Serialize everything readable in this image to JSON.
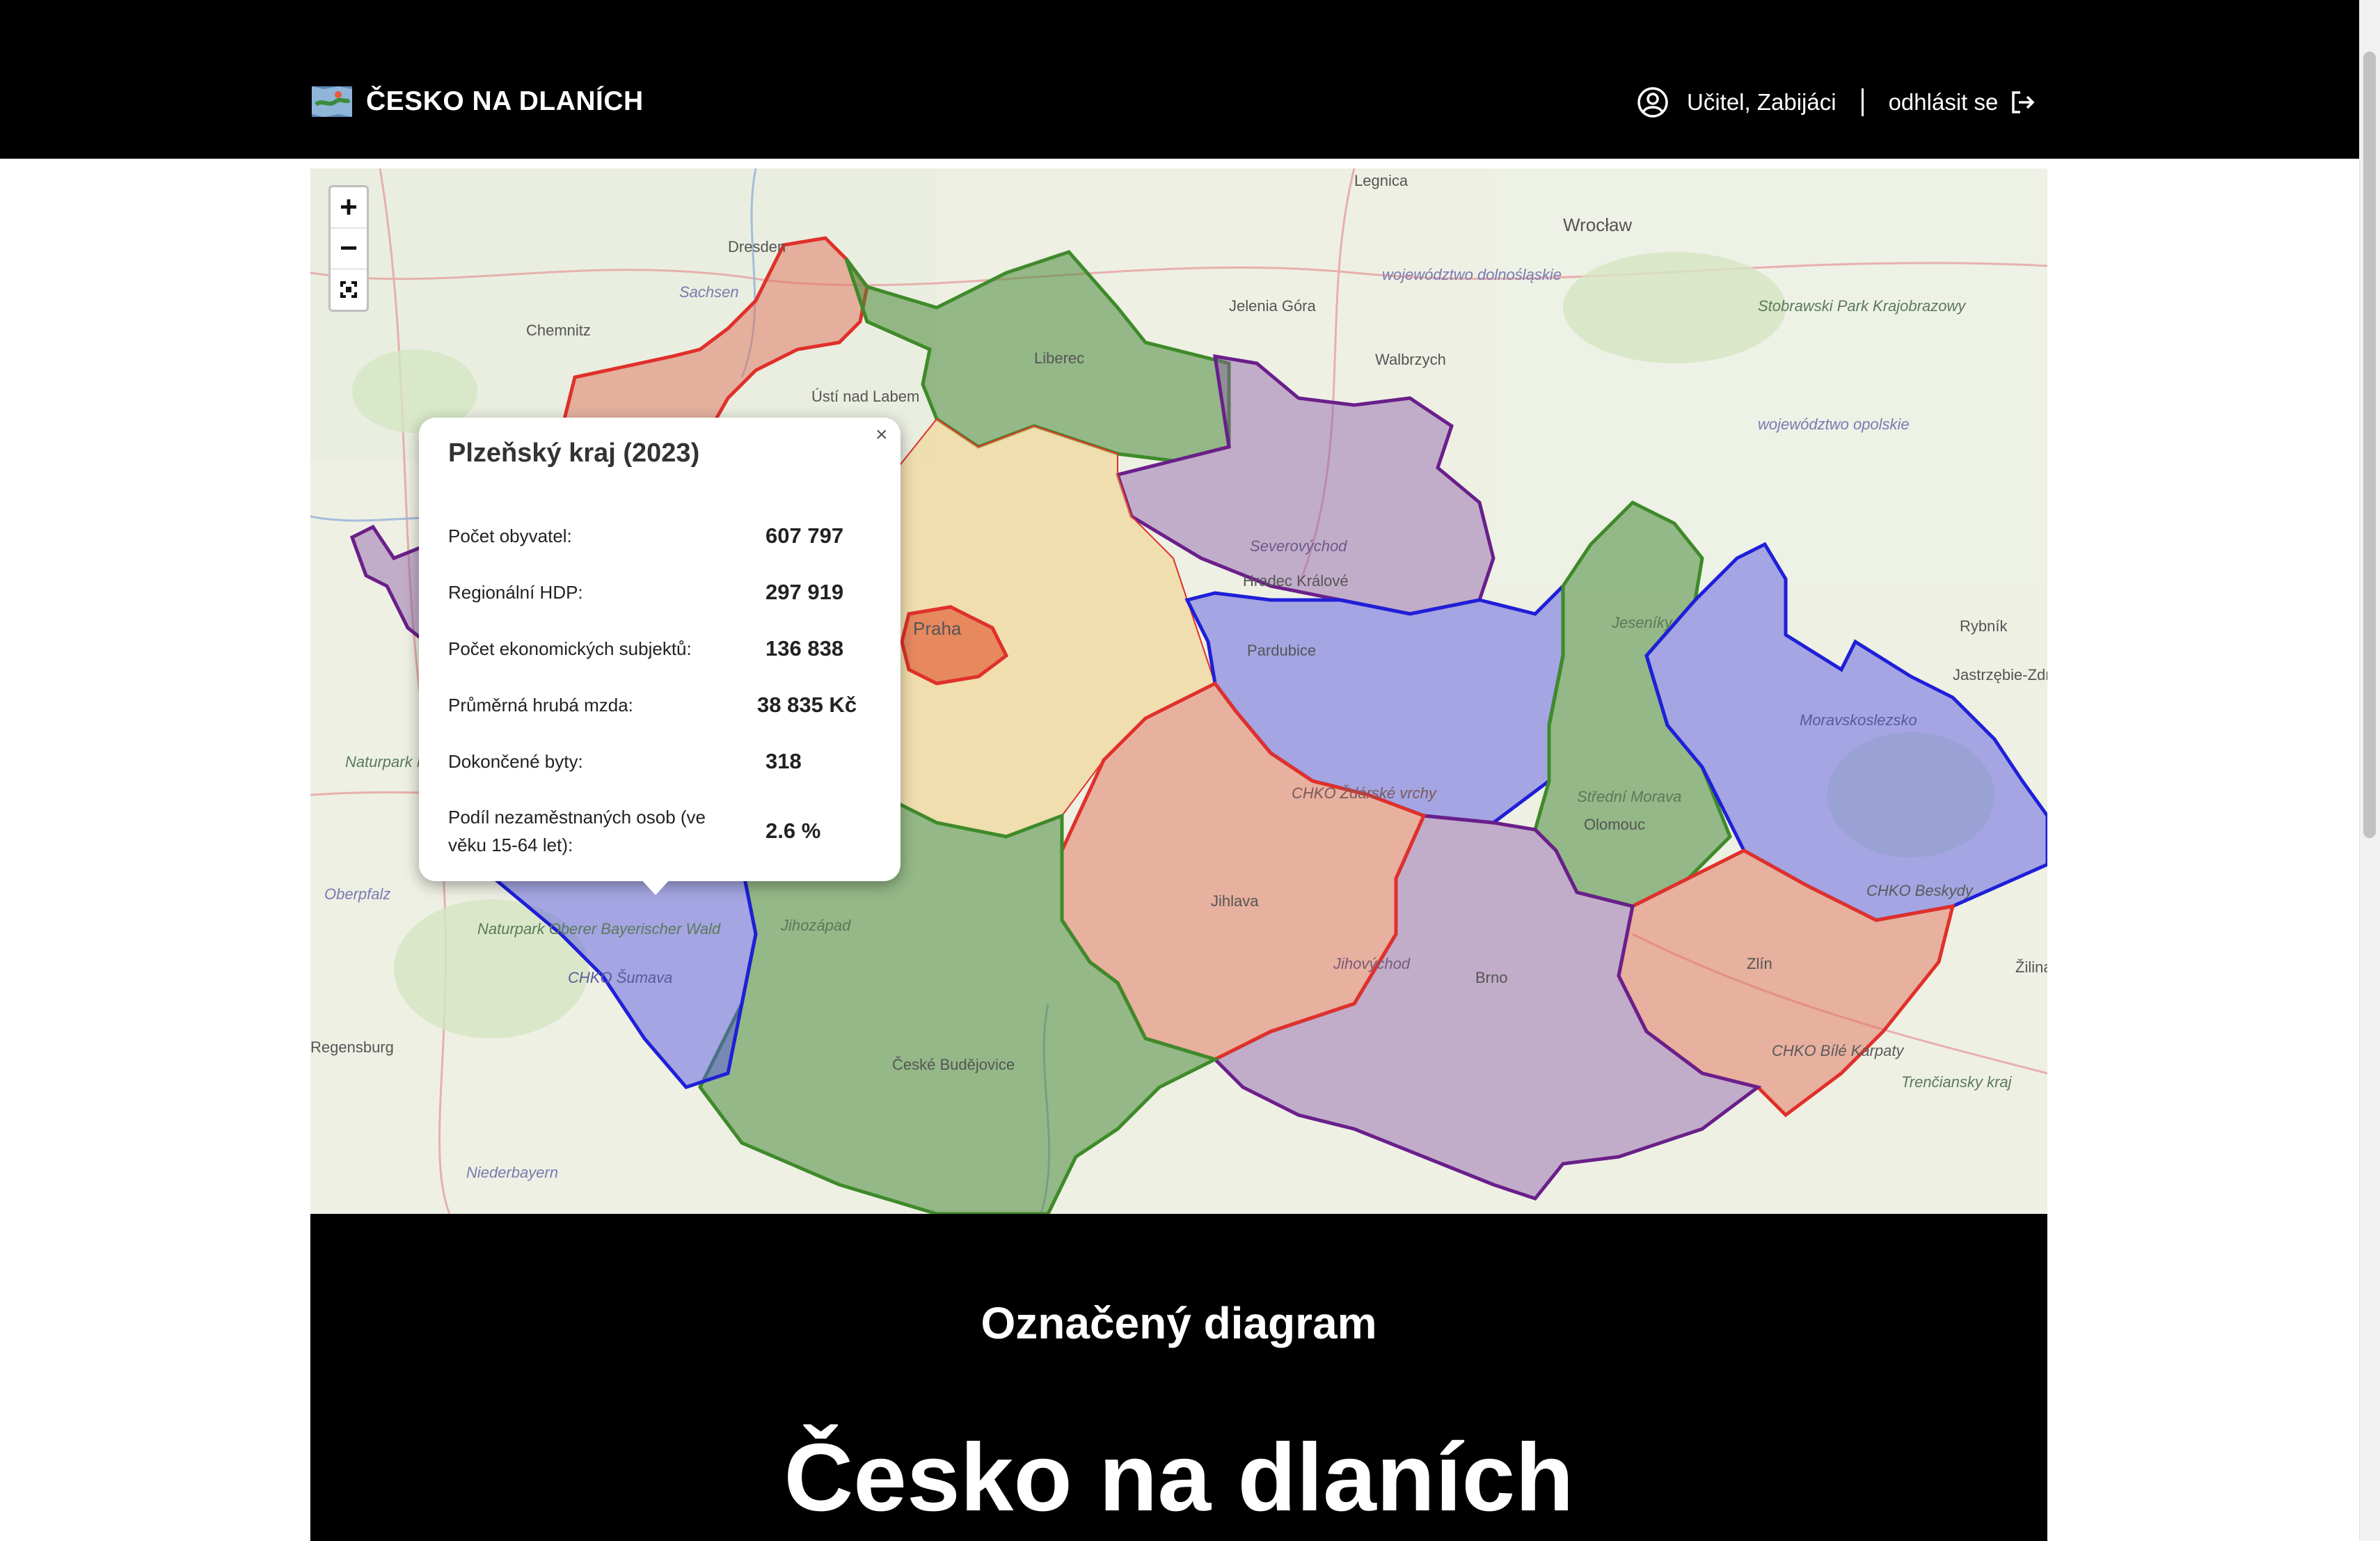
{
  "header": {
    "app_title": "ČESKO NA DLANÍCH",
    "logo_icon": "map-icon",
    "user_name": "Učitel, Zabijáci",
    "user_icon": "user-circle-icon",
    "logout_label": "odhlásit se",
    "logout_icon": "logout-icon"
  },
  "map": {
    "zoom_in": "+",
    "zoom_out": "−",
    "fullscreen_icon": "fullscreen-icon",
    "place_labels": [
      "Dresden",
      "Legnica",
      "Wrocław",
      "Sachsen",
      "Chemnitz",
      "Jelenia Góra",
      "Walbrzych",
      "Liberec",
      "Ústí nad Labem",
      "Praha",
      "Severovýchod",
      "Hradec Králové",
      "Pardubice",
      "Jeseníky",
      "Rybník",
      "Jastrzębie-Zdrój",
      "Moravskoslezsko",
      "Olomouc",
      "Střední Morava",
      "Zlín",
      "Brno",
      "Jihlava",
      "CHKO Ždárské vrchy",
      "Jihovýchod",
      "Jihozápad",
      "CHKO Šumava",
      "České Budějovice",
      "Regensburg",
      "Niederbayern",
      "Trenčiansky kraj",
      "Žilina",
      "CHKO Beskydy",
      "CHKO Bílé Karpaty",
      "województwo dolnośląskie",
      "województwo opolskie",
      "Stobrawski Park Krajobrazowy",
      "Naturpark Nördlicher Oberpfälzer Wald",
      "Naturpark Oberer Bayerischer Wald",
      "Oberpfalz"
    ]
  },
  "popup": {
    "close": "×",
    "title": "Plzeňský kraj (2023)",
    "rows": [
      {
        "label": "Počet obyvatel:",
        "value": "607 797"
      },
      {
        "label": "Regionální HDP:",
        "value": "297 919"
      },
      {
        "label": "Počet ekonomických subjektů:",
        "value": "136 838"
      },
      {
        "label": "Průměrná hrubá mzda:",
        "value": "38 835 Kč"
      },
      {
        "label": "Dokončené byty:",
        "value": "318"
      },
      {
        "label": "Podíl nezaměstnaných osob (ve věku 15-64 let):",
        "value": "2.6 %"
      }
    ]
  },
  "panel": {
    "subtitle": "Označený diagram",
    "title": "Česko na dlaních"
  },
  "colors": {
    "green": "#3f8a2a",
    "red": "#e0302a",
    "purple": "#6a1f8a",
    "blue": "#1f1fd8",
    "yellow": "#f2d28a"
  }
}
